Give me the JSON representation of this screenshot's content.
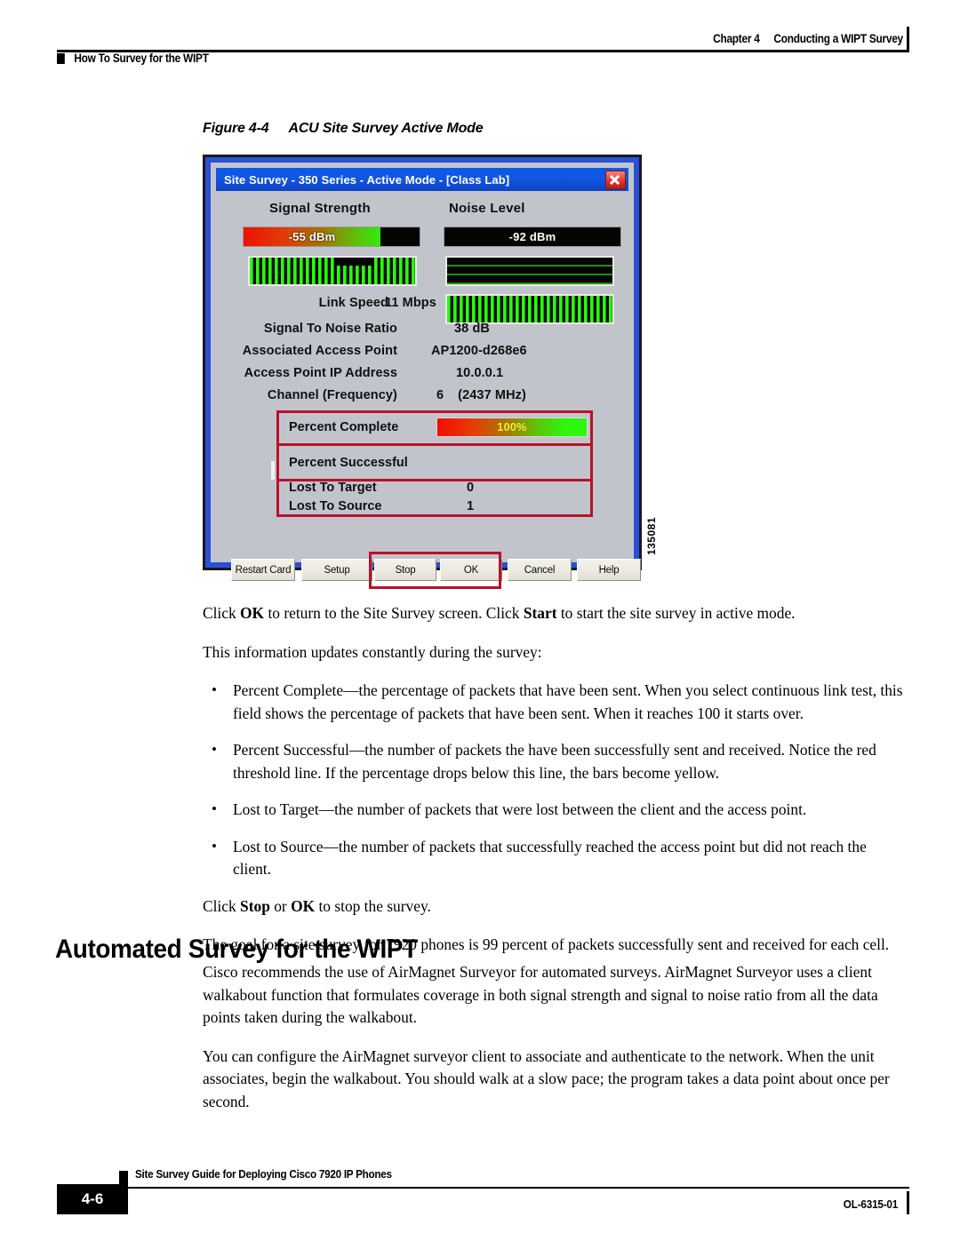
{
  "header": {
    "chapter": "Chapter 4",
    "chapter_title": "Conducting a WIPT Survey",
    "section": "How To Survey for the WIPT"
  },
  "figure": {
    "number": "Figure 4-4",
    "title": "ACU Site Survey Active Mode",
    "id_number": "135081",
    "dialog": {
      "title": "Site Survey - 350 Series - Active Mode - [Class Lab]",
      "close_label": "✕",
      "columns": {
        "signal_strength": "Signal Strength",
        "noise_level": "Noise Level"
      },
      "readouts": {
        "signal_strength_value": "-55 dBm",
        "noise_level_value": "-92 dBm"
      },
      "info_rows": [
        {
          "label": "Link Speed",
          "value": "11 Mbps"
        },
        {
          "label": "Signal To Noise Ratio",
          "value": "38 dB"
        },
        {
          "label": "Associated Access Point",
          "value": "AP1200-d268e6"
        },
        {
          "label": "Access Point IP Address",
          "value": "10.0.0.1"
        },
        {
          "label": "Channel (Frequency)",
          "value": "6",
          "value2": "(2437 MHz)"
        }
      ],
      "stats": {
        "percent_complete_label": "Percent Complete",
        "percent_complete_value": "100%",
        "percent_successful_label": "Percent Successful",
        "lost_to_target_label": "Lost To Target",
        "lost_to_target_value": "0",
        "lost_to_source_label": "Lost To Source",
        "lost_to_source_value": "1"
      },
      "buttons": [
        {
          "label": "Restart Card"
        },
        {
          "label": "Setup"
        },
        {
          "label": "Stop"
        },
        {
          "label": "OK"
        },
        {
          "label": "Cancel"
        },
        {
          "label": "Help"
        }
      ]
    }
  },
  "body": {
    "p1_a": "Click ",
    "p1_b": "OK",
    "p1_c": " to return to the Site Survey screen. Click ",
    "p1_d": "Start",
    "p1_e": " to start the site survey in active mode.",
    "p2": "This information updates constantly during the survey:",
    "bullets": [
      "Percent Complete—the percentage of packets that have been sent. When you select continuous link test, this field shows the percentage of packets that have been sent. When it reaches 100 it starts over.",
      "Percent Successful—the number of packets the have been successfully sent and received. Notice the red threshold line. If the percentage drops below this line, the bars become yellow.",
      "Lost to Target—the number of packets that were lost between the client and the access point.",
      "Lost to Source—the number of packets that successfully reached the access point but did not reach the client."
    ],
    "p3_a": "Click ",
    "p3_b": "Stop",
    "p3_c": " or ",
    "p3_d": "OK",
    "p3_e": " to stop the survey.",
    "p4": "The goal for a site survey for 7920 phones is 99 percent of packets successfully sent and received for each cell."
  },
  "section": {
    "heading": "Automated Survey for the WIPT",
    "p1": "Cisco recommends the use of AirMagnet Surveyor for automated surveys. AirMagnet Surveyor uses a client walkabout function that formulates coverage in both signal strength and signal to noise ratio from all the data points taken during the walkabout.",
    "p2": "You can configure the AirMagnet surveyor client to associate and authenticate to the network. When the unit associates, begin the walkabout. You should walk at a slow pace; the program takes a data point about once per second."
  },
  "footer": {
    "guide_title": "Site Survey Guide for Deploying Cisco 7920 IP Phones",
    "page_number": "4-6",
    "doc_number": "OL-6315-01"
  },
  "colors": {
    "title_bar": "#1355e2",
    "callout_red": "#b81228",
    "dialog_face": "#c2c4cc",
    "bar_green": "#2df70e"
  }
}
